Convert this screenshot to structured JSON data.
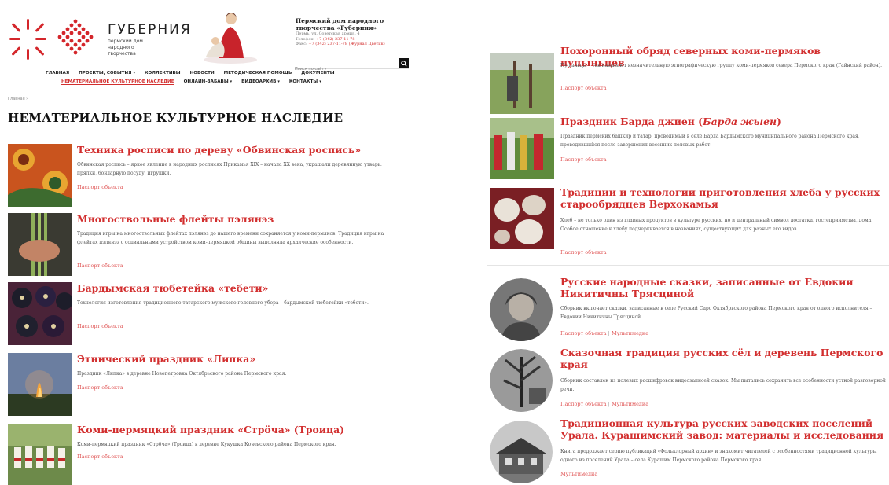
{
  "header": {
    "brand_name": "ГУБЕРНИЯ",
    "brand_sub": "пермский дом народного творчества",
    "contact_title": "Пермский дом народного творчества «Губерния»",
    "contact_address": "Пермь, ул. Советская армия, 4",
    "contact_phone_label": "Телефон:",
    "contact_phone": "+7 (342) 237-11-78",
    "contact_fax_label": "Факс:",
    "contact_fax": "+7 (342) 237-11-78 (Журнал Цветик)",
    "search_placeholder": "Поиск по сайту"
  },
  "nav": {
    "row1": [
      {
        "label": "Главная",
        "caret": ""
      },
      {
        "label": "Проекты, события",
        "caret": "▾"
      },
      {
        "label": "Коллективы",
        "caret": ""
      },
      {
        "label": "Новости",
        "caret": ""
      },
      {
        "label": "Методическая помощь",
        "caret": ""
      },
      {
        "label": "Документы",
        "caret": ""
      }
    ],
    "row2": [
      {
        "label": "Нематериальное культурное наследие",
        "caret": "",
        "active": true
      },
      {
        "label": "Онлайн-забавы",
        "caret": "▾"
      },
      {
        "label": "Видеоархив",
        "caret": "▾"
      },
      {
        "label": "Контакты",
        "caret": "▾"
      }
    ]
  },
  "breadcrumb": "Главная  ›",
  "page_title": "НЕМАТЕРИАЛЬНОЕ КУЛЬТУРНОЕ НАСЛЕДИЕ",
  "left_entries": [
    {
      "title": "Техника росписи по дереву «Обвинская роспись»",
      "desc": "Обвинская роспись – яркое явление в народных росписях Прикамья XIX – начала XX века, украшали деревянную утварь: прялки, бондарную посуду, игрушки.",
      "link": "Паспорт объекта"
    },
    {
      "title": "Многоствольные флейты пэлянэз",
      "desc": "Традиция игры на многоствольных флейтах пэлянэз до нашего времени сохраняется у коми-пермяков. Традиция игры на флейтах пэлянэз с социальными устройством коми-пермяцкой общины выполняла архаические особенности.",
      "link": "Паспорт объекта"
    },
    {
      "title": "Бардымская тюбетейка «тебети»",
      "desc": "Технология изготовления традиционного татарского мужского головного убора – бардымской тюбетейки «тебети».",
      "link": "Паспорт объекта"
    },
    {
      "title": "Этнический праздник «Липка»",
      "desc": "Праздник «Липка» в деревне Новопетровка Октябрьского района Пермского края.",
      "link": "Паспорт объекта"
    },
    {
      "title": "Коми-пермяцкий праздник «Стрӧча» (Троица)",
      "desc": "Коми-пермяцкий праздник «Стрӧча» (Троица) в деревне Кукушка Кочевского района Пермского края.",
      "link": "Паспорт объекта"
    }
  ],
  "right_entries": [
    {
      "title": "Похоронный обряд северных коми-пермяков пупыньцев",
      "title_italic": "",
      "title_after": "",
      "desc": "Пупыньцы – так называют незначительную этнографическую группу коми-пермяков севера Пермского края (Гайнский район).",
      "link": "Паспорт объекта",
      "link2": ""
    },
    {
      "title": "Праздник Барда джиен (",
      "title_italic": "Барда жыен",
      "title_after": ")",
      "desc": "Праздник пермских башкир и татар, проводимый в селе Барда Бардымского муниципального района Пермского края, проводившийся после завершения весенних полевых работ.",
      "link": "Паспорт объекта",
      "link2": ""
    },
    {
      "title": "Традиции и технологии приготовления хлеба у русских старообрядцев Верхокамья",
      "title_italic": "",
      "title_after": "",
      "desc": "Хлеб – не только один из главных продуктов в культуре русских, но и центральный символ достатка, гостеприимства, дома. Особое отношение к хлебу подчеркивается в названиях, существующих для разных его видов.",
      "link": "Паспорт объекта",
      "link2": ""
    },
    {
      "title": "Русские народные сказки, записанные от Евдокии Никитичны Трясциной",
      "title_italic": "",
      "title_after": "",
      "desc": "Сборник включает сказки, записанные в селе Русский Сарс Октябрьского района Пермского края от одного исполнителя – Евдокии Никитичны Трясциной.",
      "link": "Паспорт объекта",
      "link2": "Мультимедиа"
    },
    {
      "title": "Сказочная традиция русских сёл и деревень Пермского края",
      "title_italic": "",
      "title_after": "",
      "desc": "Сборник составлен из полевых расшифровок видеозаписей сказок. Мы пытались сохранить все особенности устной разговорной речи.",
      "link": "Паспорт объекта",
      "link2": "Мультимедиа"
    },
    {
      "title": "Традиционная культура русских заводских поселений Урала. Курашимский завод: материалы и исследования",
      "title_italic": "",
      "title_after": "",
      "desc": "Книга продолжает серию публикаций «Фольклорный архив» и знакомит читателей с особенностями традиционной культуры одного из поселений Урала – села Курашим Пермского района Пермского края.",
      "link": "Мультимедиа",
      "link2": ""
    }
  ],
  "colors": {
    "accent": "#d22e2e",
    "link": "#e05555",
    "text": "#333333"
  }
}
